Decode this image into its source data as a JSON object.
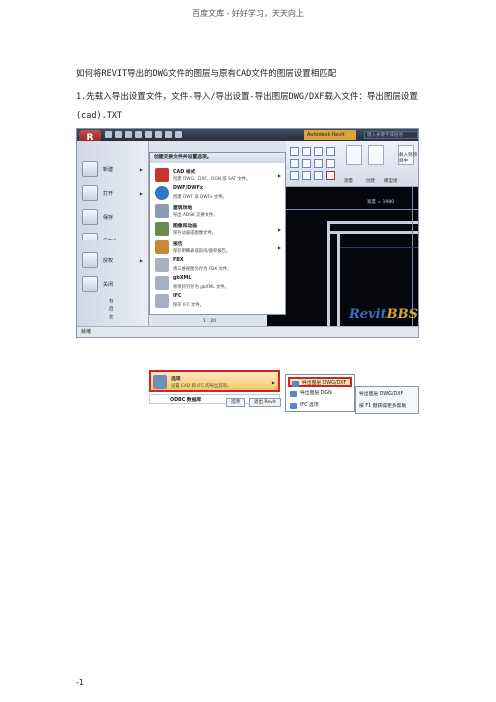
{
  "page": {
    "header": "百度文库 - 好好学习，天天向上",
    "intro": "如何将REVIT导出的DWG文件的图层与原有CAD文件的图层设置相匹配",
    "step1": "1.先载入导出设置文件，文件-导入/导出设置-导出图层DWG/DXF载入文件：导出图层设置(cad).TXT",
    "page_number": "-1"
  },
  "screenshot": {
    "app_button": "R",
    "title_chip": "Autodesk Revit",
    "search_placeholder": "键入关键字或短语",
    "ribbon_labels": [
      "测量",
      "创建",
      "模型组"
    ],
    "ribbon_side_labels": [
      "载入到项目中"
    ],
    "canvas_label": "宽度 = 1980",
    "watermark_prefix": "Revit",
    "watermark_suffix": "BBS",
    "scale": "1 : 20",
    "status": "就绪",
    "tree_items": [
      "右",
      "后",
      "左"
    ],
    "nav": [
      {
        "label": "新建"
      },
      {
        "label": "打开"
      },
      {
        "label": "保存"
      },
      {
        "label": "另存为"
      },
      {
        "label": "导出",
        "active": true
      },
      {
        "label": "发布"
      },
      {
        "label": "打印"
      },
      {
        "label": "授权"
      },
      {
        "label": "关闭"
      }
    ],
    "menu_header": "创建交换文件并设置选项。",
    "menu_items": [
      {
        "title": "CAD 格式",
        "desc": "创建 DWG、DXF、DGN 或 SAT 文件。",
        "color": "#c8342f",
        "arrow": true
      },
      {
        "title": "DWF/DWFx",
        "desc": "创建 DWF 或 DWFx 文件。",
        "color": "#2f78c2",
        "arrow": false
      },
      {
        "title": "建筑场地",
        "desc": "导出 ADSK 交换文件。",
        "color": "#8b9db4",
        "arrow": false
      },
      {
        "title": "图像和动画",
        "desc": "保存动画或图像文件。",
        "color": "#6d8a52",
        "arrow": true
      },
      {
        "title": "报告",
        "desc": "保存明细表或房间/面积报告。",
        "color": "#c28a3a",
        "arrow": true
      },
      {
        "title": "FBX",
        "desc": "将三维视图另存为 FBX 文件。",
        "color": "#a5b0c2",
        "arrow": false
      },
      {
        "title": "gbXML",
        "desc": "将项目另存为 gbXML 文件。",
        "color": "#a5b0c2",
        "arrow": false
      },
      {
        "title": "IFC",
        "desc": "保存 IFC 文件。",
        "color": "#a5b0c2",
        "arrow": false
      },
      {
        "title": "选项",
        "desc": "设置 CAD 和 IFC 的导出选项。",
        "color": "#6f8fb8",
        "arrow": true,
        "active": true
      },
      {
        "title": "ODBC 数据库",
        "desc": "",
        "color": "#a5b0c2",
        "arrow": false
      }
    ],
    "menu_buttons": [
      "选项",
      "退出 Revit"
    ],
    "submenu": [
      {
        "label": "导出图层 DWG/DXF",
        "active": true
      },
      {
        "label": "导出图层 DGN"
      },
      {
        "label": "IFC 选项"
      }
    ],
    "popup": [
      "导出图层 DWG/DXF",
      "按 F1 键获得更多帮助"
    ]
  }
}
